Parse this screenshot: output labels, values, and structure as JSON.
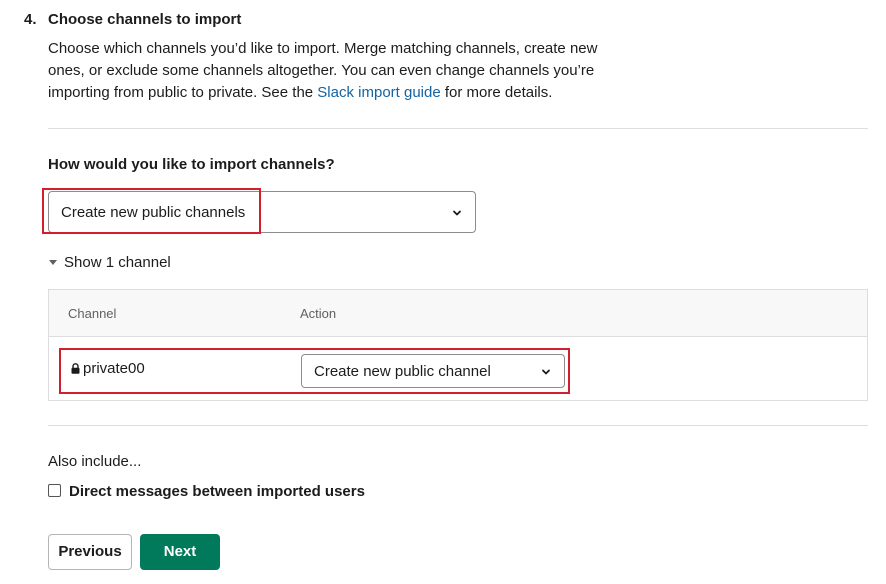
{
  "step": {
    "number": "4.",
    "title": "Choose channels to import"
  },
  "description": {
    "before_link": "Choose which channels you’d like to import. Merge matching channels, create new ones, or exclude some channels altogether. You can even change channels you’re importing from public to private. See the ",
    "link_text": "Slack import guide",
    "after_link": " for more details."
  },
  "import_question": "How would you like to import channels?",
  "import_select": {
    "value": "Create new public channels",
    "icon": "chevron-down-icon"
  },
  "toggle": {
    "label": "Show 1 channel",
    "icon": "caret-down-icon"
  },
  "table": {
    "headers": {
      "channel": "Channel",
      "action": "Action"
    },
    "rows": [
      {
        "channel": "private00",
        "icon": "lock-icon",
        "action": "Create new public channel"
      }
    ]
  },
  "also_include": {
    "heading": "Also include...",
    "checkbox_label": "Direct messages between imported users",
    "checked": false
  },
  "buttons": {
    "previous": "Previous",
    "next": "Next"
  },
  "colors": {
    "link": "#1264a3",
    "primary": "#007a5a",
    "highlight": "#d0202e"
  }
}
